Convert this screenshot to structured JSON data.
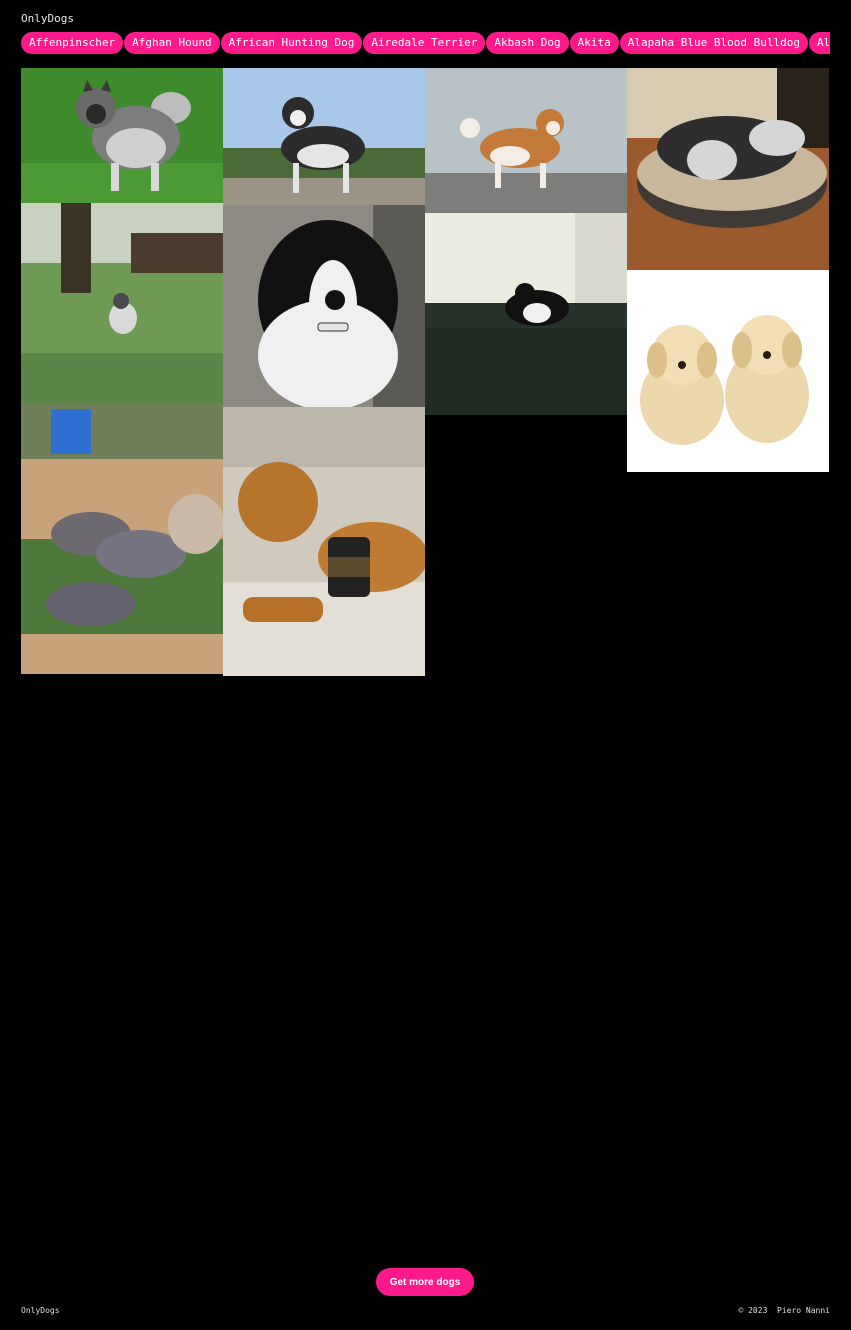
{
  "header": {
    "brand": "OnlyDogs"
  },
  "breeds": [
    "Affenpinscher",
    "Afghan Hound",
    "African Hunting Dog",
    "Airedale Terrier",
    "Akbash Dog",
    "Akita",
    "Alapaha Blue Blood Bulldog",
    "Alaskan Husky"
  ],
  "gallery": {
    "photos": [
      {
        "name": "keeshond-on-grass"
      },
      {
        "name": "husky-on-gravel"
      },
      {
        "name": "akita-on-pebble-beach"
      },
      {
        "name": "shih-tzu-on-dog-bed"
      },
      {
        "name": "sheltie-in-garden"
      },
      {
        "name": "border-collie-closeup"
      },
      {
        "name": "border-collie-on-sofa"
      },
      {
        "name": "labrador-puppies"
      },
      {
        "name": "pitbull-puppies-sleeping"
      },
      {
        "name": "dog-with-jar"
      }
    ]
  },
  "actions": {
    "more_label": "Get more dogs"
  },
  "footer": {
    "brand": "OnlyDogs",
    "copyright": "© 2023  Piero Nanni"
  },
  "colors": {
    "accent": "#ff1a8c",
    "background": "#000000"
  }
}
